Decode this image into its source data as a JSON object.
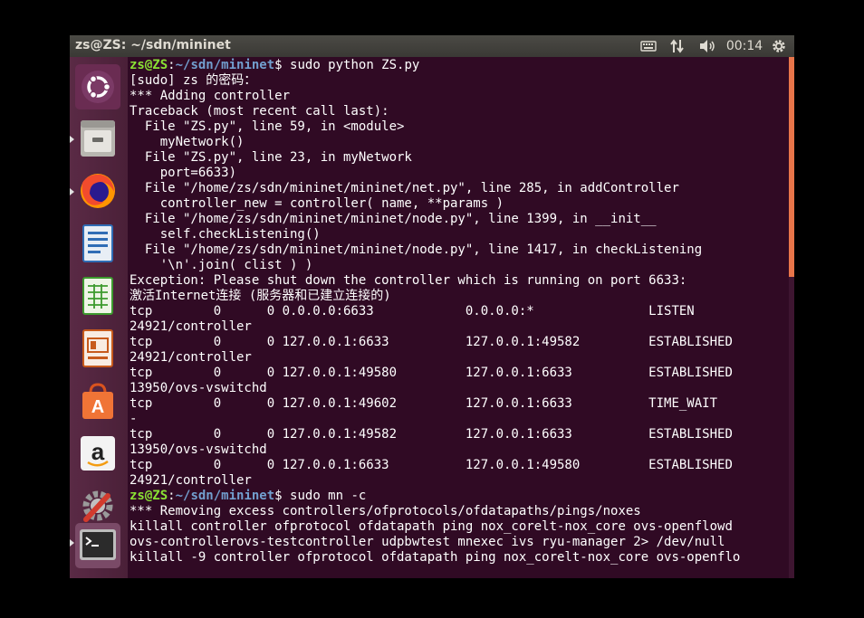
{
  "topbar": {
    "title": "zs@ZS: ~/sdn/mininet",
    "clock": "00:14",
    "icons": [
      "keyboard-icon",
      "network-icon",
      "volume-icon",
      "gear-icon"
    ]
  },
  "launcher": {
    "items": [
      "ubuntu-dash",
      "files",
      "firefox",
      "libreoffice-writer",
      "libreoffice-calc",
      "libreoffice-impress",
      "ubuntu-software",
      "amazon",
      "system-settings",
      "terminal"
    ]
  },
  "prompt": {
    "user": "zs@ZS",
    "sep": ":",
    "path": "~/sdn/mininet",
    "symbol": "$ "
  },
  "terminal": {
    "cmd1": "sudo python ZS.py",
    "l1": "[sudo] zs 的密码：",
    "l2": "*** Adding controller",
    "l3": "Traceback (most recent call last):",
    "l4": "  File \"ZS.py\", line 59, in <module>",
    "l5": "    myNetwork()",
    "l6": "  File \"ZS.py\", line 23, in myNetwork",
    "l7": "    port=6633)",
    "l8": "  File \"/home/zs/sdn/mininet/mininet/net.py\", line 285, in addController",
    "l9": "    controller_new = controller( name, **params )",
    "l10": "  File \"/home/zs/sdn/mininet/mininet/node.py\", line 1399, in __init__",
    "l11": "    self.checkListening()",
    "l12": "  File \"/home/zs/sdn/mininet/mininet/node.py\", line 1417, in checkListening",
    "l13": "    '\\n'.join( clist ) )",
    "l14": "Exception: Please shut down the controller which is running on port 6633:",
    "l15": "激活Internet连接 (服务器和已建立连接的)",
    "l16": "tcp        0      0 0.0.0.0:6633            0.0.0.0:*               LISTEN",
    "l17": "24921/controller",
    "l18": "tcp        0      0 127.0.0.1:6633          127.0.0.1:49582         ESTABLISHED",
    "l19": "24921/controller",
    "l20": "tcp        0      0 127.0.0.1:49580         127.0.0.1:6633          ESTABLISHED",
    "l21": "13950/ovs-vswitchd",
    "l22": "tcp        0      0 127.0.0.1:49602         127.0.0.1:6633          TIME_WAIT",
    "l23": "-",
    "l24": "tcp        0      0 127.0.0.1:49582         127.0.0.1:6633          ESTABLISHED",
    "l25": "13950/ovs-vswitchd",
    "l26": "tcp        0      0 127.0.0.1:6633          127.0.0.1:49580         ESTABLISHED",
    "l27": "24921/controller",
    "cmd2": "sudo mn -c",
    "l28": "*** Removing excess controllers/ofprotocols/ofdatapaths/pings/noxes",
    "l29": "killall controller ofprotocol ofdatapath ping nox_corelt-nox_core ovs-openflowd",
    "l30": "ovs-controllerovs-testcontroller udpbwtest mnexec ivs ryu-manager 2> /dev/null",
    "l31": "killall -9 controller ofprotocol ofdatapath ping nox_corelt-nox_core ovs-openflo"
  },
  "colors": {
    "background": "#300a24",
    "prompt_user": "#8ae234",
    "prompt_path": "#729fcf",
    "scroll_thumb": "#e8754a"
  }
}
